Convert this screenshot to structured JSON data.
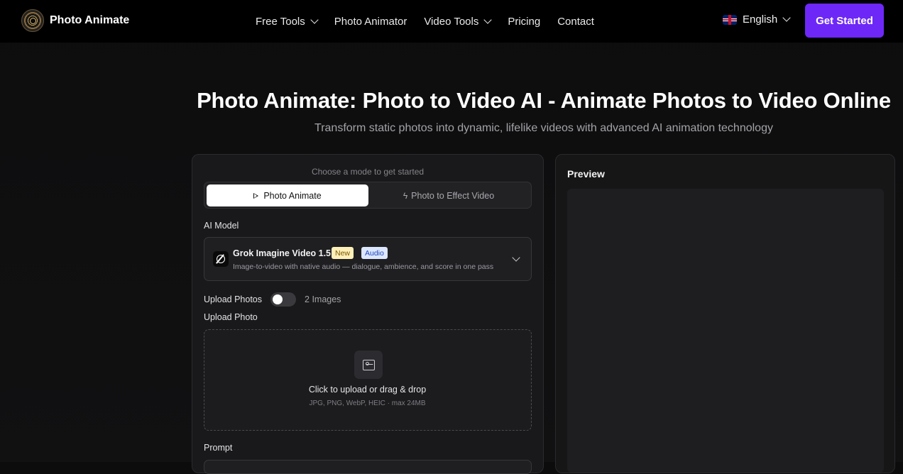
{
  "brand": {
    "name": "Photo Animate"
  },
  "nav": {
    "links": [
      "Free Tools",
      "Photo Animator",
      "Video Tools",
      "Pricing",
      "Contact"
    ],
    "language": "English",
    "cta": "Get Started"
  },
  "hero": {
    "title": "Photo Animate: Photo to Video AI - Animate Photos to Video Online",
    "subtitle": "Transform static photos into dynamic, lifelike videos with advanced AI animation technology"
  },
  "form": {
    "mode_hint": "Choose a mode to get started",
    "modes": [
      "Photo Animate",
      "Photo to Effect Video"
    ],
    "model_label": "AI Model",
    "model": {
      "name": "Grok Imagine Video 1.5",
      "badge_new": "New",
      "badge_audio": "Audio",
      "description": "Image-to-video with native audio — dialogue, ambience, and score in one pass"
    },
    "upload_toggle_label": "Upload Photos",
    "upload_toggle_alt": "2 Images",
    "upload_label": "Upload Photo",
    "dropzone_title": "Click to upload or drag & drop",
    "dropzone_sub": "JPG, PNG, WebP, HEIC · max 24MB",
    "prompt_label": "Prompt"
  },
  "preview": {
    "title": "Preview"
  },
  "colors": {
    "accent": "#6d28f7",
    "badge_new_bg": "#fdf0b8",
    "badge_audio_bg": "#dce7ff"
  }
}
